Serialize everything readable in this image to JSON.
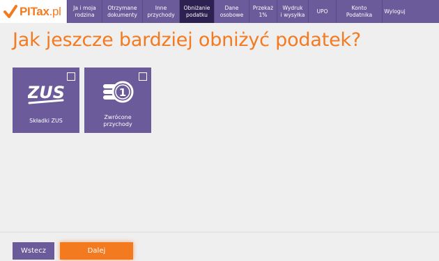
{
  "logo": {
    "brand": "PITax",
    "suffix": ".pl"
  },
  "nav": [
    {
      "label": "Ja i moja\nrodzina",
      "active": false
    },
    {
      "label": "Otrzymane\ndokumenty",
      "active": false
    },
    {
      "label": "Inne\nprzychody",
      "active": false
    },
    {
      "label": "Obniżanie\npodatku",
      "active": true
    },
    {
      "label": "Dane\nosobowe",
      "active": false
    },
    {
      "label": "Przekaż\n1%",
      "active": false
    },
    {
      "label": "Wydruk\ni wysyłka",
      "active": false
    },
    {
      "label": "UPO",
      "active": false
    },
    {
      "label": "Konto\nPodatnika",
      "active": false
    },
    {
      "label": "Wyloguj",
      "active": false
    }
  ],
  "page_title": "Jak jeszcze bardziej obniżyć podatek?",
  "tiles": [
    {
      "label": "Składki ZUS",
      "icon": "zus-logo-icon",
      "checked": false,
      "icon_text": "ZUS"
    },
    {
      "label": "Zwrócone\nprzychody",
      "icon": "coins-icon",
      "checked": false,
      "icon_text": "1"
    }
  ],
  "footer": {
    "back_label": "Wstecz",
    "next_label": "Dalej"
  },
  "colors": {
    "brand_purple": "#6b5b9a",
    "active_nav": "#2c2150",
    "accent_orange": "#f47a20"
  }
}
